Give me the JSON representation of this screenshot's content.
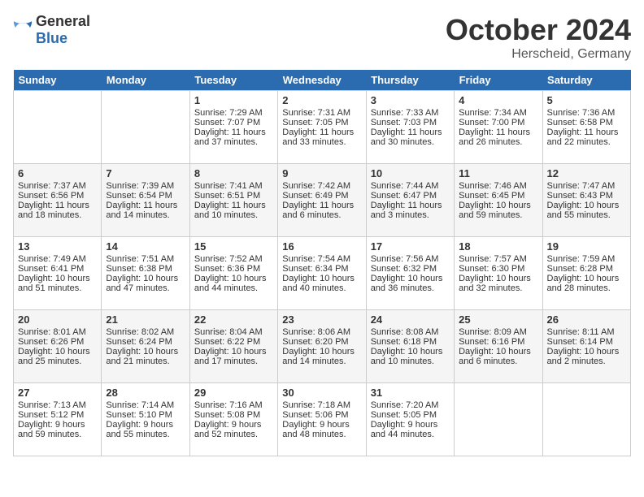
{
  "header": {
    "logo_general": "General",
    "logo_blue": "Blue",
    "month": "October 2024",
    "location": "Herscheid, Germany"
  },
  "days_of_week": [
    "Sunday",
    "Monday",
    "Tuesday",
    "Wednesday",
    "Thursday",
    "Friday",
    "Saturday"
  ],
  "weeks": [
    [
      {
        "day": "",
        "sunrise": "",
        "sunset": "",
        "daylight": ""
      },
      {
        "day": "",
        "sunrise": "",
        "sunset": "",
        "daylight": ""
      },
      {
        "day": "1",
        "sunrise": "Sunrise: 7:29 AM",
        "sunset": "Sunset: 7:07 PM",
        "daylight": "Daylight: 11 hours and 37 minutes."
      },
      {
        "day": "2",
        "sunrise": "Sunrise: 7:31 AM",
        "sunset": "Sunset: 7:05 PM",
        "daylight": "Daylight: 11 hours and 33 minutes."
      },
      {
        "day": "3",
        "sunrise": "Sunrise: 7:33 AM",
        "sunset": "Sunset: 7:03 PM",
        "daylight": "Daylight: 11 hours and 30 minutes."
      },
      {
        "day": "4",
        "sunrise": "Sunrise: 7:34 AM",
        "sunset": "Sunset: 7:00 PM",
        "daylight": "Daylight: 11 hours and 26 minutes."
      },
      {
        "day": "5",
        "sunrise": "Sunrise: 7:36 AM",
        "sunset": "Sunset: 6:58 PM",
        "daylight": "Daylight: 11 hours and 22 minutes."
      }
    ],
    [
      {
        "day": "6",
        "sunrise": "Sunrise: 7:37 AM",
        "sunset": "Sunset: 6:56 PM",
        "daylight": "Daylight: 11 hours and 18 minutes."
      },
      {
        "day": "7",
        "sunrise": "Sunrise: 7:39 AM",
        "sunset": "Sunset: 6:54 PM",
        "daylight": "Daylight: 11 hours and 14 minutes."
      },
      {
        "day": "8",
        "sunrise": "Sunrise: 7:41 AM",
        "sunset": "Sunset: 6:51 PM",
        "daylight": "Daylight: 11 hours and 10 minutes."
      },
      {
        "day": "9",
        "sunrise": "Sunrise: 7:42 AM",
        "sunset": "Sunset: 6:49 PM",
        "daylight": "Daylight: 11 hours and 6 minutes."
      },
      {
        "day": "10",
        "sunrise": "Sunrise: 7:44 AM",
        "sunset": "Sunset: 6:47 PM",
        "daylight": "Daylight: 11 hours and 3 minutes."
      },
      {
        "day": "11",
        "sunrise": "Sunrise: 7:46 AM",
        "sunset": "Sunset: 6:45 PM",
        "daylight": "Daylight: 10 hours and 59 minutes."
      },
      {
        "day": "12",
        "sunrise": "Sunrise: 7:47 AM",
        "sunset": "Sunset: 6:43 PM",
        "daylight": "Daylight: 10 hours and 55 minutes."
      }
    ],
    [
      {
        "day": "13",
        "sunrise": "Sunrise: 7:49 AM",
        "sunset": "Sunset: 6:41 PM",
        "daylight": "Daylight: 10 hours and 51 minutes."
      },
      {
        "day": "14",
        "sunrise": "Sunrise: 7:51 AM",
        "sunset": "Sunset: 6:38 PM",
        "daylight": "Daylight: 10 hours and 47 minutes."
      },
      {
        "day": "15",
        "sunrise": "Sunrise: 7:52 AM",
        "sunset": "Sunset: 6:36 PM",
        "daylight": "Daylight: 10 hours and 44 minutes."
      },
      {
        "day": "16",
        "sunrise": "Sunrise: 7:54 AM",
        "sunset": "Sunset: 6:34 PM",
        "daylight": "Daylight: 10 hours and 40 minutes."
      },
      {
        "day": "17",
        "sunrise": "Sunrise: 7:56 AM",
        "sunset": "Sunset: 6:32 PM",
        "daylight": "Daylight: 10 hours and 36 minutes."
      },
      {
        "day": "18",
        "sunrise": "Sunrise: 7:57 AM",
        "sunset": "Sunset: 6:30 PM",
        "daylight": "Daylight: 10 hours and 32 minutes."
      },
      {
        "day": "19",
        "sunrise": "Sunrise: 7:59 AM",
        "sunset": "Sunset: 6:28 PM",
        "daylight": "Daylight: 10 hours and 28 minutes."
      }
    ],
    [
      {
        "day": "20",
        "sunrise": "Sunrise: 8:01 AM",
        "sunset": "Sunset: 6:26 PM",
        "daylight": "Daylight: 10 hours and 25 minutes."
      },
      {
        "day": "21",
        "sunrise": "Sunrise: 8:02 AM",
        "sunset": "Sunset: 6:24 PM",
        "daylight": "Daylight: 10 hours and 21 minutes."
      },
      {
        "day": "22",
        "sunrise": "Sunrise: 8:04 AM",
        "sunset": "Sunset: 6:22 PM",
        "daylight": "Daylight: 10 hours and 17 minutes."
      },
      {
        "day": "23",
        "sunrise": "Sunrise: 8:06 AM",
        "sunset": "Sunset: 6:20 PM",
        "daylight": "Daylight: 10 hours and 14 minutes."
      },
      {
        "day": "24",
        "sunrise": "Sunrise: 8:08 AM",
        "sunset": "Sunset: 6:18 PM",
        "daylight": "Daylight: 10 hours and 10 minutes."
      },
      {
        "day": "25",
        "sunrise": "Sunrise: 8:09 AM",
        "sunset": "Sunset: 6:16 PM",
        "daylight": "Daylight: 10 hours and 6 minutes."
      },
      {
        "day": "26",
        "sunrise": "Sunrise: 8:11 AM",
        "sunset": "Sunset: 6:14 PM",
        "daylight": "Daylight: 10 hours and 2 minutes."
      }
    ],
    [
      {
        "day": "27",
        "sunrise": "Sunrise: 7:13 AM",
        "sunset": "Sunset: 5:12 PM",
        "daylight": "Daylight: 9 hours and 59 minutes."
      },
      {
        "day": "28",
        "sunrise": "Sunrise: 7:14 AM",
        "sunset": "Sunset: 5:10 PM",
        "daylight": "Daylight: 9 hours and 55 minutes."
      },
      {
        "day": "29",
        "sunrise": "Sunrise: 7:16 AM",
        "sunset": "Sunset: 5:08 PM",
        "daylight": "Daylight: 9 hours and 52 minutes."
      },
      {
        "day": "30",
        "sunrise": "Sunrise: 7:18 AM",
        "sunset": "Sunset: 5:06 PM",
        "daylight": "Daylight: 9 hours and 48 minutes."
      },
      {
        "day": "31",
        "sunrise": "Sunrise: 7:20 AM",
        "sunset": "Sunset: 5:05 PM",
        "daylight": "Daylight: 9 hours and 44 minutes."
      },
      {
        "day": "",
        "sunrise": "",
        "sunset": "",
        "daylight": ""
      },
      {
        "day": "",
        "sunrise": "",
        "sunset": "",
        "daylight": ""
      }
    ]
  ]
}
